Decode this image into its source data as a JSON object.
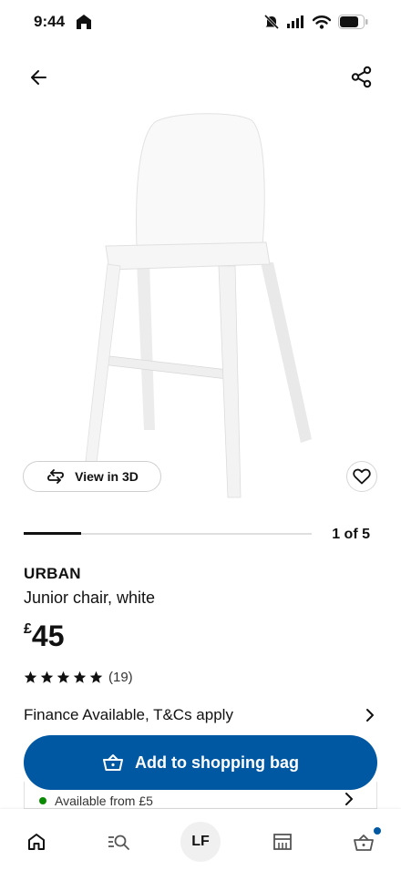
{
  "status_bar": {
    "time": "9:44",
    "icons": [
      "home-glyph",
      "muted-bell-icon",
      "signal-icon",
      "wifi-icon",
      "battery-icon"
    ]
  },
  "nav": {
    "back_icon": "arrow-left-icon",
    "share_icon": "share-icon"
  },
  "gallery": {
    "view_3d_label": "View in 3D",
    "favourite_icon": "heart-outline-icon",
    "progress": 0.2,
    "counter": "1 of 5"
  },
  "product": {
    "name": "URBAN",
    "description": "Junior chair, white",
    "currency": "£",
    "price": "45",
    "rating": 5,
    "rating_count": "(19)"
  },
  "finance": {
    "label": "Finance Available, T&Cs apply"
  },
  "add_to_bag": {
    "label": "Add to shopping bag",
    "icon": "basket-icon"
  },
  "availability": {
    "text": "Available from £5",
    "dot_color": "#0a8a00"
  },
  "bottom_nav": {
    "tabs": [
      {
        "icon": "home-icon"
      },
      {
        "icon": "search-list-icon"
      },
      {
        "label": "LF"
      },
      {
        "icon": "store-icon"
      },
      {
        "icon": "basket-icon"
      }
    ],
    "basket_badge_color": "#0058a3"
  },
  "colors": {
    "brand_blue": "#0058a3",
    "text": "#111111"
  }
}
